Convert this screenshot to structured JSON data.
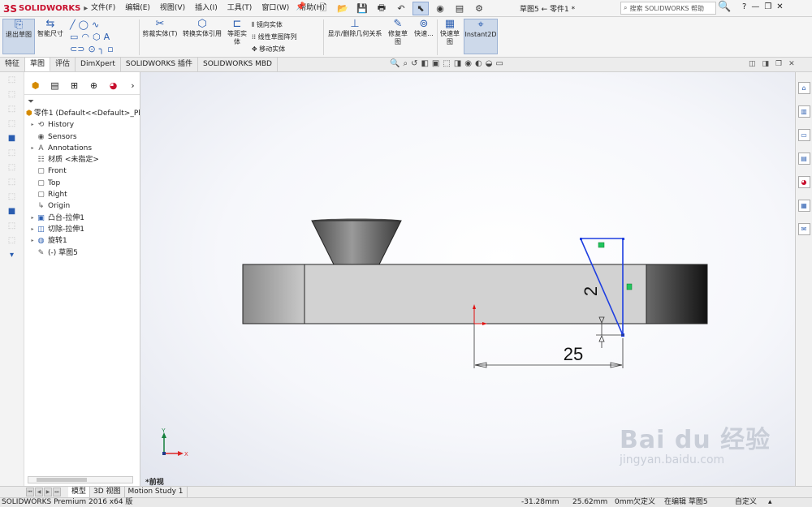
{
  "app": {
    "brand": "SOLIDWORKS",
    "brand_mark": "3S",
    "title": "草图5 ← 零件1 *"
  },
  "menu": [
    "文件(F)",
    "编辑(E)",
    "视图(V)",
    "插入(I)",
    "工具(T)",
    "窗口(W)",
    "帮助(H)"
  ],
  "help": {
    "placeholder": "搜索 SOLIDWORKS 帮助"
  },
  "commands": {
    "exit_sketch": "退出草图",
    "smart_dim": "智能尺寸",
    "trim": "剪裁实体(T)",
    "convert": "转换实体引用",
    "offset": "等距实体",
    "mirror": "镜向实体",
    "linear_pattern": "线性草图阵列",
    "move": "移动实体",
    "relations": "显示/删除几何关系",
    "repair": "修复草图",
    "quick_snaps": "快速...",
    "rapid_sketch": "快速草图",
    "instant2d": "Instant2D"
  },
  "tabs": [
    "特征",
    "草图",
    "评估",
    "DimXpert",
    "SOLIDWORKS 插件",
    "SOLIDWORKS MBD"
  ],
  "active_tab_index": 1,
  "tree": [
    {
      "label": "零件1  (Default<<Default>_Ph",
      "icon": "part-icon",
      "expand": "",
      "indent": 0
    },
    {
      "label": "History",
      "icon": "history-icon",
      "expand": "▸",
      "indent": 1
    },
    {
      "label": "Sensors",
      "icon": "sensors-icon",
      "expand": "",
      "indent": 1
    },
    {
      "label": "Annotations",
      "icon": "annotations-icon",
      "expand": "▸",
      "indent": 1
    },
    {
      "label": "材质 <未指定>",
      "icon": "material-icon",
      "expand": "",
      "indent": 1
    },
    {
      "label": "Front",
      "icon": "plane-icon",
      "expand": "",
      "indent": 1
    },
    {
      "label": "Top",
      "icon": "plane-icon",
      "expand": "",
      "indent": 1
    },
    {
      "label": "Right",
      "icon": "plane-icon",
      "expand": "",
      "indent": 1
    },
    {
      "label": "Origin",
      "icon": "origin-icon",
      "expand": "",
      "indent": 1
    },
    {
      "label": "凸台-拉伸1",
      "icon": "extrude-icon",
      "expand": "▸",
      "indent": 1
    },
    {
      "label": "切除-拉伸1",
      "icon": "cut-icon",
      "expand": "▸",
      "indent": 1
    },
    {
      "label": "旋转1",
      "icon": "revolve-icon",
      "expand": "▸",
      "indent": 1
    },
    {
      "label": "(-) 草图5",
      "icon": "sketch-icon",
      "expand": "",
      "indent": 1
    }
  ],
  "viewport": {
    "view_name": "*前视",
    "dims": [
      "2",
      "25"
    ],
    "axis_x": "X",
    "axis_y": "Y",
    "watermark_1": "Bai du 经验",
    "watermark_2": "jingyan.baidu.com"
  },
  "bottom_tabs": [
    "模型",
    "3D 视图",
    "Motion Study 1"
  ],
  "status": {
    "product": "SOLIDWORKS Premium 2016 x64 版",
    "x": "-31.28mm",
    "y": "25.62mm",
    "z": "0mm",
    "defined": "欠定义",
    "editing": "在编辑 草图5",
    "custom": "自定义"
  }
}
